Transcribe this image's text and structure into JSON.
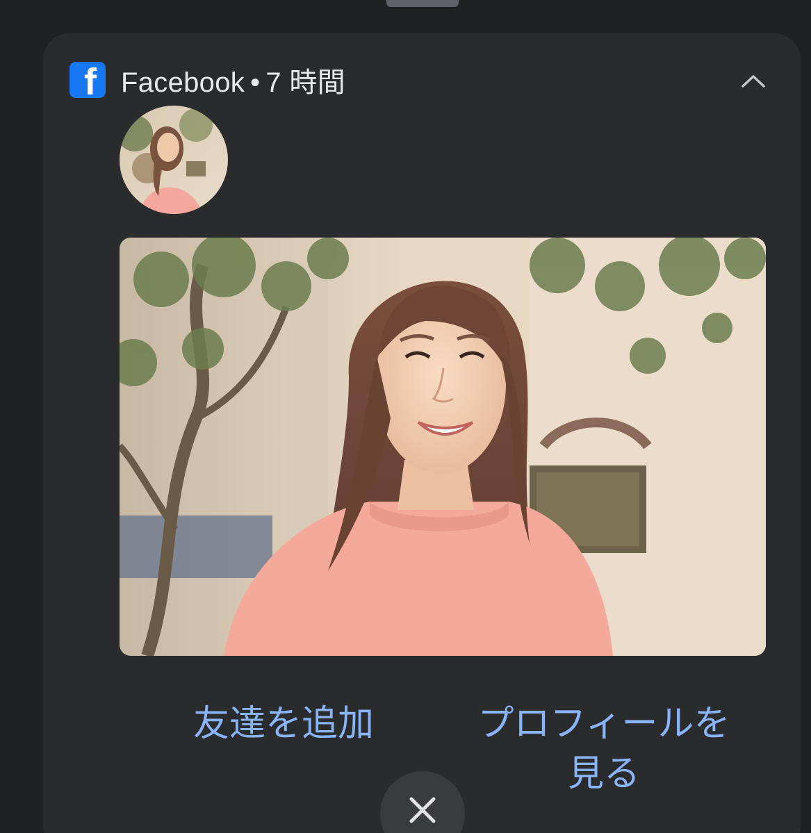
{
  "notification": {
    "app_name": "Facebook",
    "separator": "•",
    "time_ago": "7 時間",
    "app_icon": "facebook-f-icon",
    "collapse_icon": "chevron-up-icon"
  },
  "actions": {
    "add_friend": "友達を追加",
    "view_profile": "プロフィールを見る"
  },
  "close": {
    "icon": "close-icon"
  },
  "colors": {
    "background": "#1f2022",
    "card": "#2a2b2d",
    "facebook_blue": "#1877f2",
    "action_text": "#8ab4f8",
    "header_text": "#e8eaed"
  }
}
